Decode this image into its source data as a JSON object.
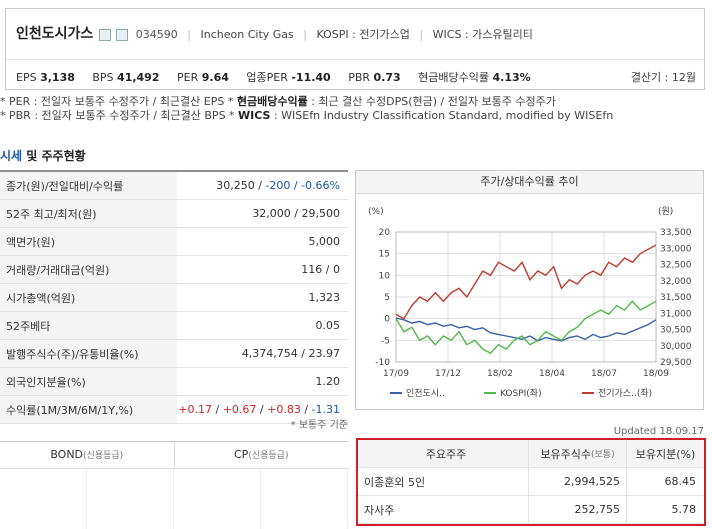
{
  "company": {
    "name": "인천도시가스",
    "code": "034590",
    "name_en": "Incheon City Gas",
    "market": "KOSPI : 전기가스업",
    "wics": "WICS : 가스유틸리티"
  },
  "metrics": {
    "eps_label": "EPS",
    "eps": "3,138",
    "bps_label": "BPS",
    "bps": "41,492",
    "per_label": "PER",
    "per": "9.64",
    "ind_per_label": "업종PER",
    "ind_per": "-11.40",
    "pbr_label": "PBR",
    "pbr": "0.73",
    "div_label": "현금배당수익률",
    "div": "4.13%",
    "fiscal": "결산기 : 12월"
  },
  "notes": {
    "line1_a": "* PER : 전일자 보통주 수정주가 / 최근결산 EPS * ",
    "line1_b": "현금배당수익률",
    "line1_c": " : 최근 결산 수정DPS(현금) / 전일자 보통주 수정주가",
    "line2_a": "* PBR : 전일자 보통주 수정주가 / 최근결산 BPS * ",
    "line2_b": "WICS",
    "line2_c": " : WISEfn Industry Classification Standard, modified by WISEfn"
  },
  "section": {
    "title_blue": "시세",
    "title_rest": " 및 주주현황"
  },
  "price_table": {
    "rows": [
      {
        "label": "종가(원)/전일대비/수익률",
        "v1": "30,250 / ",
        "v2": "-200 / -0.66%"
      },
      {
        "label": "52주 최고/최저(원)",
        "value": "32,000 / 29,500"
      },
      {
        "label": "액면가(원)",
        "value": "5,000"
      },
      {
        "label": "거래량/거래대금(억원)",
        "value": "116 / 0"
      },
      {
        "label": "시가총액(억원)",
        "value": "1,323"
      },
      {
        "label": "52주베타",
        "value": "0.05"
      },
      {
        "label": "발행주식수(주)/유통비율(%)",
        "value": "4,374,754 / 23.97"
      },
      {
        "label": "외국인지분율(%)",
        "value": "1.20"
      },
      {
        "label": "수익률(1M/3M/6M/1Y,%)",
        "p1": "+0.17",
        "p2": "+0.67",
        "p3": "+0.83",
        "p4": "-1.31"
      }
    ],
    "basis": "* 보통주 기준"
  },
  "chart": {
    "title": "주가/상대수익률 추이",
    "left_unit": "(%)",
    "right_unit": "(원)",
    "colors": {
      "stock": "#3a5fa8",
      "kospi": "#4fb848",
      "sector": "#c0392b",
      "grid": "#dddddd"
    }
  },
  "chart_data": {
    "type": "line",
    "xlabels": [
      "17/09",
      "17/12",
      "18/02",
      "18/04",
      "18/07",
      "18/09"
    ],
    "yleft_ticks": [
      20,
      15,
      10,
      5,
      0,
      -5,
      -10
    ],
    "yleft_lim": [
      -10,
      20
    ],
    "yright_ticks": [
      "33,500",
      "33,000",
      "32,500",
      "32,000",
      "31,500",
      "31,000",
      "30,500",
      "30,000",
      "29,500"
    ],
    "yright_lim": [
      29500,
      33500
    ],
    "grid": true,
    "legend_position": "bottom",
    "series": [
      {
        "name": "인천도시..",
        "axis": "right",
        "values": [
          30850,
          30800,
          30700,
          30750,
          30650,
          30700,
          30600,
          30650,
          30550,
          30600,
          30500,
          30550,
          30400,
          30350,
          30300,
          30250,
          30200,
          30300,
          30150,
          30250,
          30200,
          30150,
          30250,
          30300,
          30200,
          30350,
          30250,
          30300,
          30400,
          30350,
          30450,
          30550,
          30650,
          30800
        ]
      },
      {
        "name": "KOSPI(좌)",
        "axis": "left",
        "values": [
          0,
          -3,
          -2,
          -5,
          -4,
          -6,
          -4,
          -5,
          -3,
          -6,
          -5,
          -7,
          -8,
          -6,
          -7,
          -5,
          -4,
          -6,
          -5,
          -3,
          -4,
          -5,
          -3,
          -2,
          0,
          1,
          2,
          1,
          3,
          2,
          4,
          2,
          3,
          4
        ]
      },
      {
        "name": "전기가스..(좌)",
        "axis": "left",
        "values": [
          1,
          0,
          3,
          5,
          4,
          6,
          4,
          6,
          7,
          5,
          8,
          11,
          10,
          13,
          12,
          11,
          13,
          9,
          11,
          10,
          12,
          7,
          9,
          8,
          10,
          11,
          10,
          13,
          12,
          14,
          13,
          15,
          16,
          17
        ]
      }
    ]
  },
  "updated": "Updated 18.09.17",
  "bond": {
    "bond_label": "BOND",
    "bond_grade": "(신용등급)",
    "cp_label": "CP",
    "cp_grade": "(신용등급)"
  },
  "shareholders": {
    "headers": {
      "name": "주요주주",
      "shares": "보유주식수",
      "shares_note": "(보통)",
      "pct": "보유지분(%)"
    },
    "rows": [
      {
        "name": "이종훈외 5인",
        "shares": "2,994,525",
        "pct": "68.45"
      },
      {
        "name": "자사주",
        "shares": "252,755",
        "pct": "5.78"
      }
    ]
  }
}
